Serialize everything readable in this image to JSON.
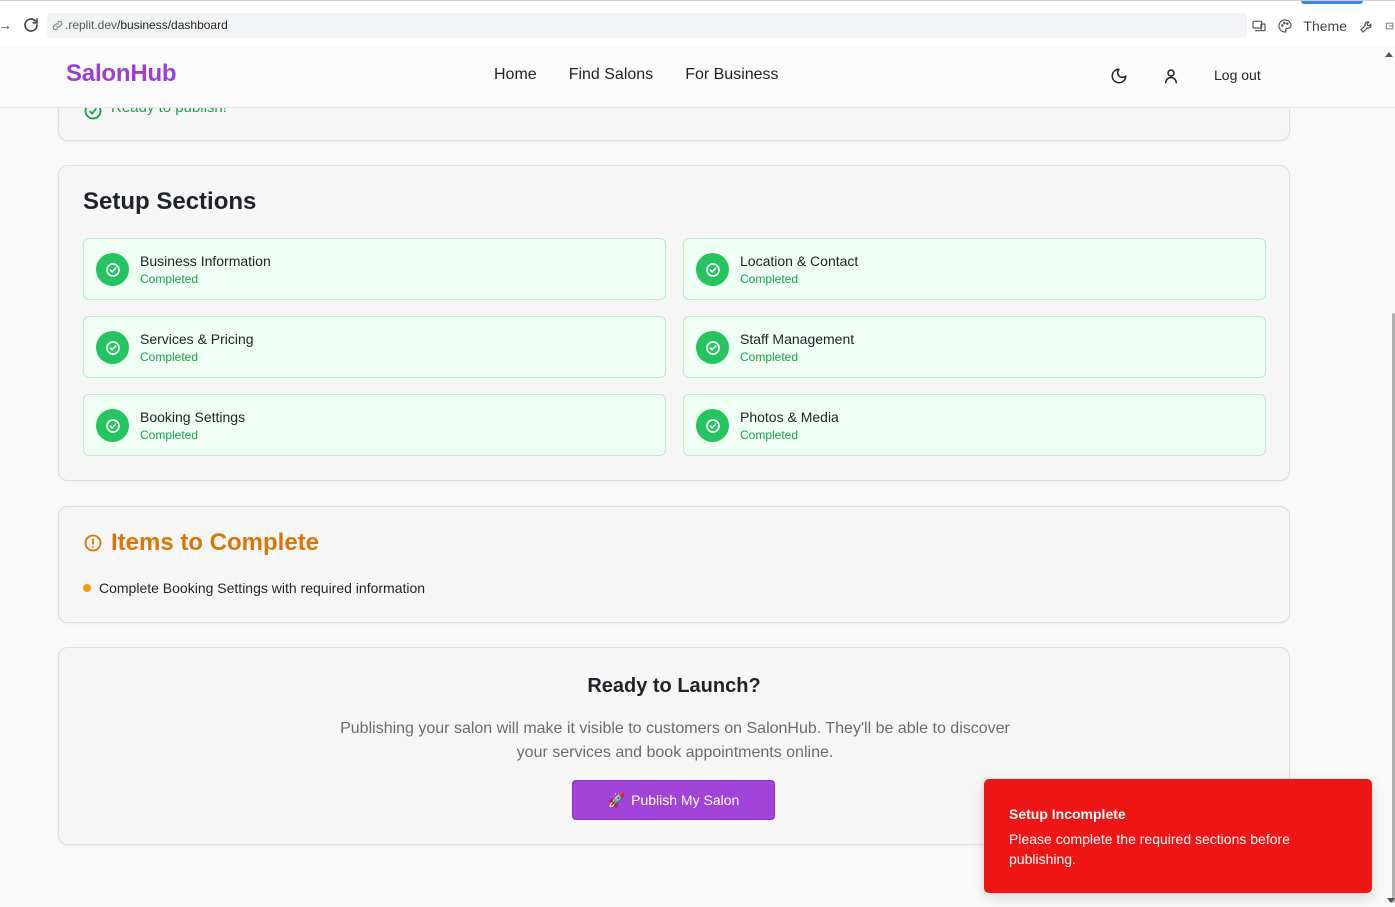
{
  "browser": {
    "url_prefix": ".replit.dev",
    "url_path": "/business/dashboard",
    "theme_label": "Theme"
  },
  "header": {
    "logo": "SalonHub",
    "nav": [
      "Home",
      "Find Salons",
      "For Business"
    ],
    "logout": "Log out"
  },
  "status_card": {
    "ready_text": "Ready to publish!"
  },
  "setup": {
    "title": "Setup Sections",
    "sections": [
      {
        "name": "Business Information",
        "status": "Completed"
      },
      {
        "name": "Location & Contact",
        "status": "Completed"
      },
      {
        "name": "Services & Pricing",
        "status": "Completed"
      },
      {
        "name": "Staff Management",
        "status": "Completed"
      },
      {
        "name": "Booking Settings",
        "status": "Completed"
      },
      {
        "name": "Photos & Media",
        "status": "Completed"
      }
    ]
  },
  "items": {
    "title": "Items to Complete",
    "list": [
      "Complete Booking Settings with required information"
    ]
  },
  "launch": {
    "title": "Ready to Launch?",
    "description": "Publishing your salon will make it visible to customers on SalonHub. They'll be able to discover your services and book appointments online.",
    "button_label": "Publish My Salon",
    "button_icon": "🚀"
  },
  "toast": {
    "title": "Setup Incomplete",
    "message": "Please complete the required sections before publishing."
  },
  "colors": {
    "brand": "#9b3fd1",
    "success": "#22c55e",
    "warning": "#d97706",
    "error": "#ee1515"
  }
}
